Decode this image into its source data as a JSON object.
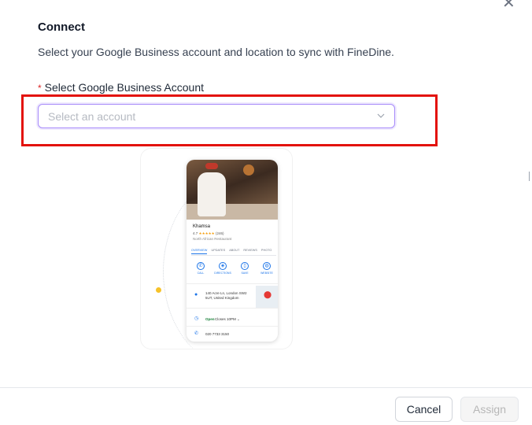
{
  "dialog": {
    "close_glyph": "✕",
    "title": "Connect",
    "subtitle": "Select your Google Business account and location to sync with FineDine."
  },
  "account_field": {
    "required_mark": "*",
    "label": "Select Google Business Account",
    "placeholder": "Select an account"
  },
  "preview": {
    "business_name": "Khamsa",
    "rating": "4.7",
    "stars": "★★★★★",
    "review_count": "(246)",
    "category": "North African Restaurant",
    "tabs": [
      "OVERVIEW",
      "UPDATES",
      "ABOUT",
      "REVIEWS",
      "PHOTO"
    ],
    "actions": [
      "CALL",
      "DIRECTIONS",
      "SAVE",
      "WEBSITE"
    ],
    "address": "140 Acre Ln, London SW2 5UT, United Kingdom",
    "hours_status": "Open",
    "hours_detail": "Closes 10PM ⌄",
    "phone": "020 7733 3150"
  },
  "footer": {
    "cancel_label": "Cancel",
    "assign_label": "Assign"
  },
  "colors": {
    "highlight": "#e3120b",
    "focus_border": "#a78bfa",
    "required": "#dc2626",
    "google_blue": "#1a73e8",
    "disabled_text": "#b7b7b7"
  }
}
